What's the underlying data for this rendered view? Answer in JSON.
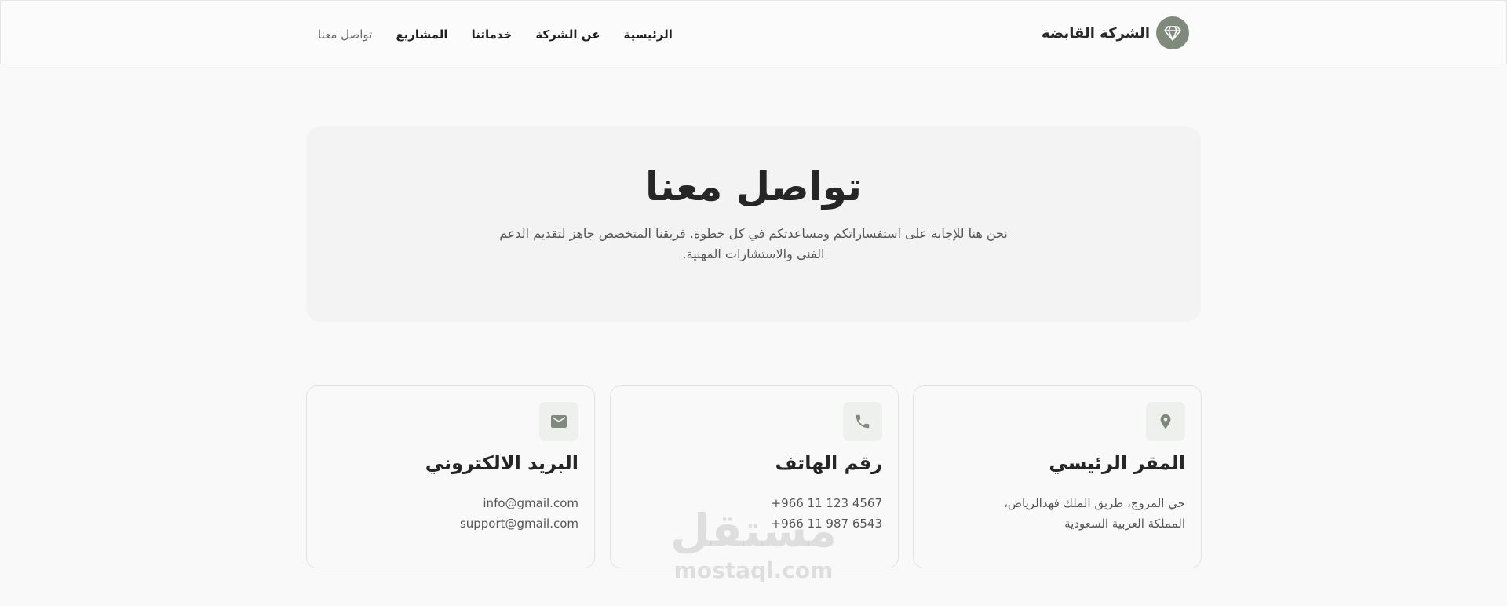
{
  "header": {
    "brand_name": "الشركة القابضة",
    "brand_icon": "diamond-icon",
    "nav": [
      {
        "label": "الرئيسية"
      },
      {
        "label": "عن الشركة"
      },
      {
        "label": "خدماتنا"
      },
      {
        "label": "المشاريع"
      },
      {
        "label": "تواصل معنا",
        "active": true
      }
    ]
  },
  "hero": {
    "title": "تواصل معنا",
    "subtitle": "نحن هنا للإجابة على استفساراتكم ومساعدتكم في كل خطوة. فريقنا المتخصص جاهز لتقديم الدعم الفني والاستشارات المهنية."
  },
  "cards": [
    {
      "icon": "location-pin-icon",
      "title": "المقر الرئيسي",
      "lines": [
        "حي المروج، طريق الملك فهدالرياض،",
        "المملكة العربية السعودية"
      ]
    },
    {
      "icon": "phone-icon",
      "title": "رقم الهاتف",
      "lines": [
        "+966 11 123 4567",
        "+966 11 987 6543"
      ]
    },
    {
      "icon": "mail-icon",
      "title": "البريد الالكتروني",
      "lines": [
        "info@gmail.com",
        "support@gmail.com"
      ]
    }
  ],
  "watermark": {
    "arabic": "مستقل",
    "latin": "mostaql.com"
  },
  "colors": {
    "accent": "#7f8a7d",
    "icon_bg": "#eef0ee",
    "hero_bg": "#f3f3f3",
    "page_bg": "#f9f9f9"
  }
}
